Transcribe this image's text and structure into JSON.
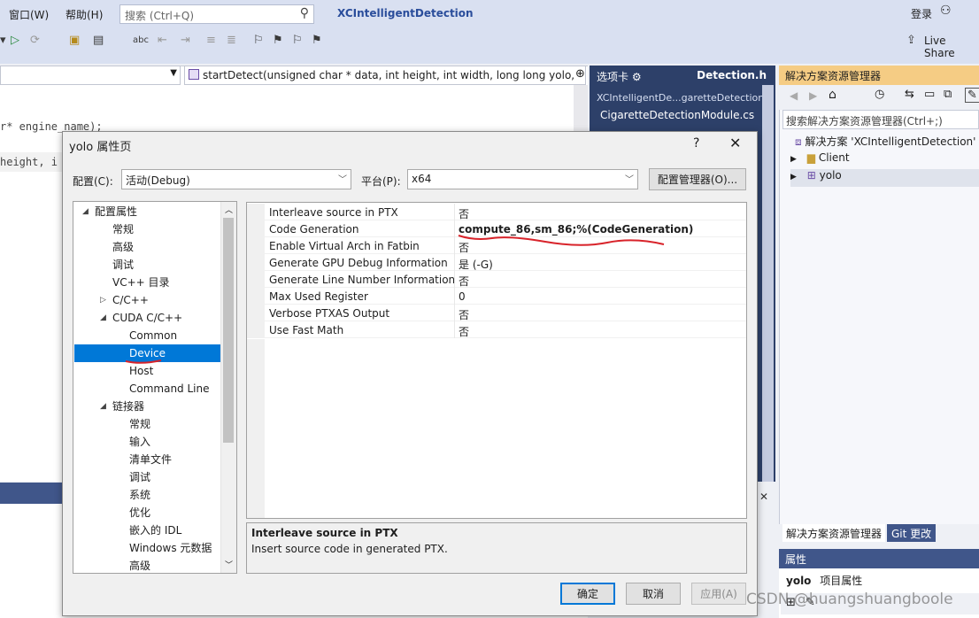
{
  "menu": {
    "window": "窗口(W)",
    "help": "帮助(H)"
  },
  "search": {
    "placeholder": "搜索 (Ctrl+Q)"
  },
  "app_title": "XCIntelligentDetection",
  "account": {
    "login": "登录"
  },
  "toolbar": {
    "live_share": "Live Share"
  },
  "editor": {
    "nav_member": "startDetect(unsigned char * data, int height, int width, long long yolo,",
    "code_line1": "r* engine_name);",
    "code_line2": " height, i"
  },
  "tabs_panel": {
    "header": "选项卡",
    "active_file": "Detection.h",
    "items": [
      "XCIntelligentDe...garetteDetection",
      "CigaretteDetectionModule.cs"
    ]
  },
  "solution_explorer": {
    "title": "解决方案资源管理器",
    "search_placeholder": "搜索解决方案资源管理器(Ctrl+;)",
    "solution_label": "解决方案 'XCIntelligentDetection'",
    "projects": [
      "Client",
      "yolo"
    ],
    "tab_active": "解决方案资源管理器",
    "tab_git": "Git 更改"
  },
  "properties": {
    "title": "属性",
    "subject": "yolo",
    "subtitle": "项目属性"
  },
  "dialog": {
    "title": "yolo 属性页",
    "config_label": "配置(C):",
    "config_value": "活动(Debug)",
    "platform_label": "平台(P):",
    "platform_value": "x64",
    "config_manager": "配置管理器(O)...",
    "tree": {
      "config_props": "配置属性",
      "general": "常规",
      "advanced": "高级",
      "debugging": "调试",
      "vc_dirs": "VC++ 目录",
      "cpp": "C/C++",
      "cuda": "CUDA C/C++",
      "cuda_common": "Common",
      "cuda_device": "Device",
      "cuda_host": "Host",
      "cuda_cmdline": "Command Line",
      "linker": "链接器",
      "linker_general": "常规",
      "linker_input": "输入",
      "linker_manifest": "清单文件",
      "linker_debug": "调试",
      "linker_system": "系统",
      "linker_optimize": "优化",
      "linker_idl": "嵌入的 IDL",
      "linker_winmd": "Windows 元数据",
      "linker_advanced": "高级"
    },
    "properties": [
      {
        "name": "Interleave source in PTX",
        "value": "否"
      },
      {
        "name": "Code Generation",
        "value": "compute_86,sm_86;%(CodeGeneration)"
      },
      {
        "name": "Enable Virtual Arch in Fatbin",
        "value": "否"
      },
      {
        "name": "Generate GPU Debug Information",
        "value": "是 (-G)"
      },
      {
        "name": "Generate Line Number Information",
        "value": "否"
      },
      {
        "name": "Max Used Register",
        "value": "0"
      },
      {
        "name": "Verbose PTXAS Output",
        "value": "否"
      },
      {
        "name": "Use Fast Math",
        "value": "否"
      }
    ],
    "description_title": "Interleave source in PTX",
    "description_text": "Insert source code in generated PTX.",
    "ok": "确定",
    "cancel": "取消",
    "apply": "应用(A)"
  },
  "watermark": "CSDN @huangshuangboole",
  "colors": {
    "accent": "#0078d7",
    "annotation": "#d8232a",
    "app_title": "#2a4d9b"
  }
}
